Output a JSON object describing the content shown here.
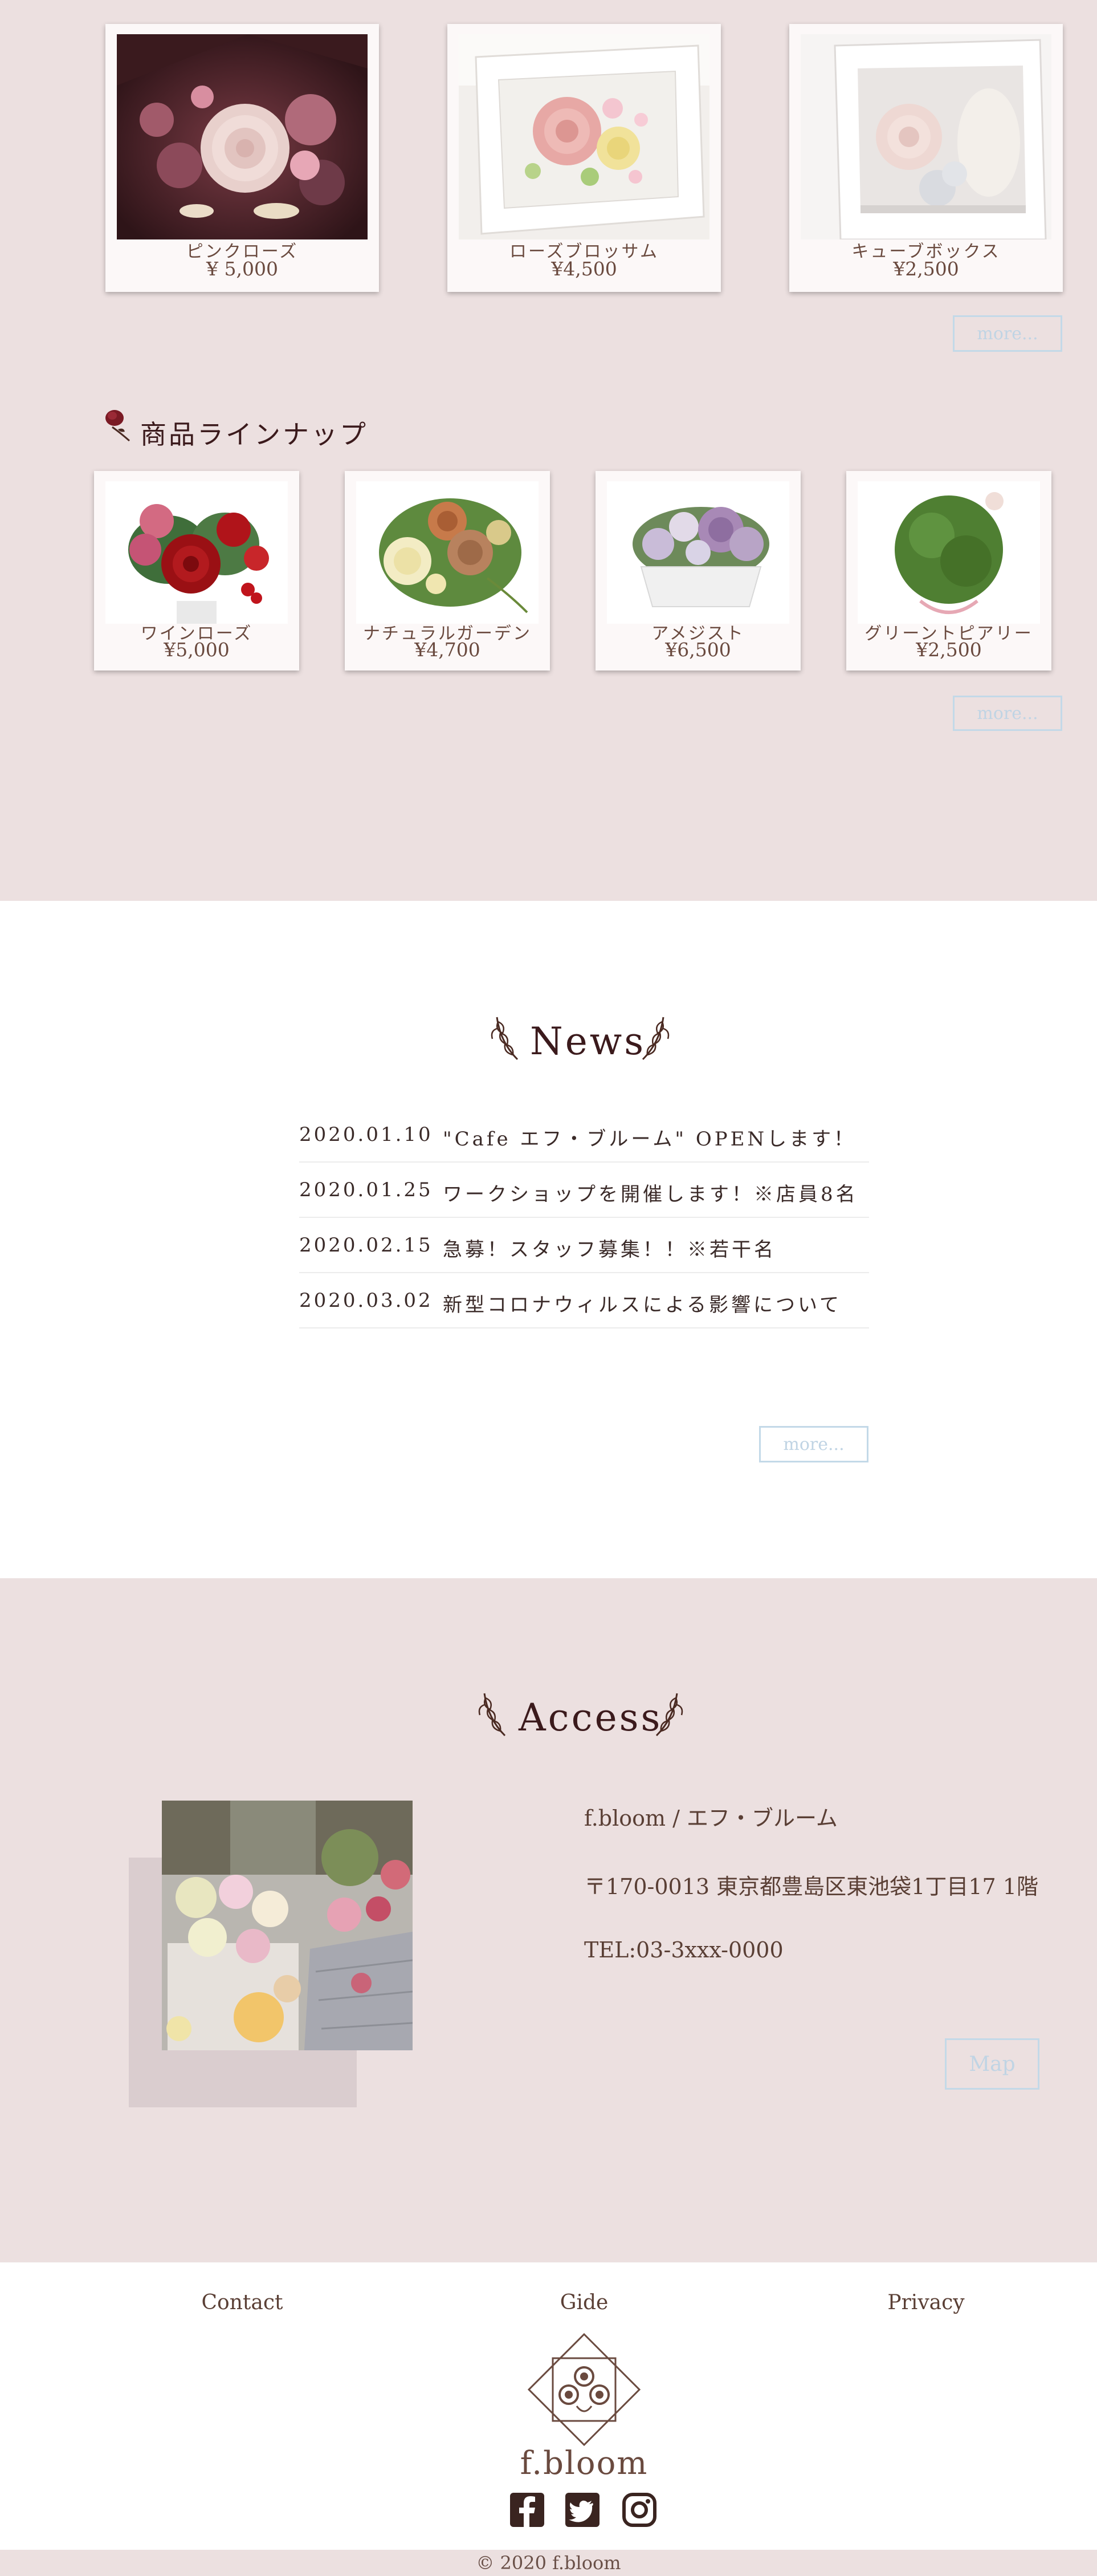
{
  "featured": {
    "items": [
      {
        "name": "ピンクローズ",
        "price": "¥ 5,000"
      },
      {
        "name": "ローズブロッサム",
        "price": "¥4,500"
      },
      {
        "name": "キューブボックス",
        "price": "¥2,500"
      }
    ],
    "more_label": "more..."
  },
  "lineup": {
    "heading": "商品ラインナップ",
    "items": [
      {
        "name": "ワインローズ",
        "price": "¥5,000"
      },
      {
        "name": "ナチュラルガーデン",
        "price": "¥4,700"
      },
      {
        "name": "アメジスト",
        "price": "¥6,500"
      },
      {
        "name": "グリーントピアリー",
        "price": "¥2,500"
      }
    ],
    "more_label": "more..."
  },
  "news": {
    "title": "News",
    "items": [
      {
        "date": "2020.01.10",
        "text": "\"Cafe エフ・ブルーム\" OPENします！"
      },
      {
        "date": "2020.01.25",
        "text": "ワークショップを開催します！※店員8名"
      },
      {
        "date": "2020.02.15",
        "text": "急募！スタッフ募集！！※若干名"
      },
      {
        "date": "2020.03.02",
        "text": "新型コロナウィルスによる影響について"
      }
    ],
    "more_label": "more..."
  },
  "access": {
    "title": "Access",
    "shop_name": "f.bloom / エフ・ブルーム",
    "address": "〒170-0013 東京都豊島区東池袋1丁目17 1階",
    "tel": "TEL:03-3xxx-0000",
    "map_label": "Map"
  },
  "footer": {
    "links": [
      "Contact",
      "Gide",
      "Privacy"
    ],
    "logo_text": "f.bloom",
    "social_icons": [
      "facebook-icon",
      "twitter-icon",
      "instagram-icon"
    ],
    "copyright": "© 2020 f.bloom"
  },
  "colors": {
    "section_bg": "#ece0e0",
    "brand_dark": "#3b1a1c",
    "button_border": "#c3d9e8",
    "text_brown": "#5a3f35"
  }
}
